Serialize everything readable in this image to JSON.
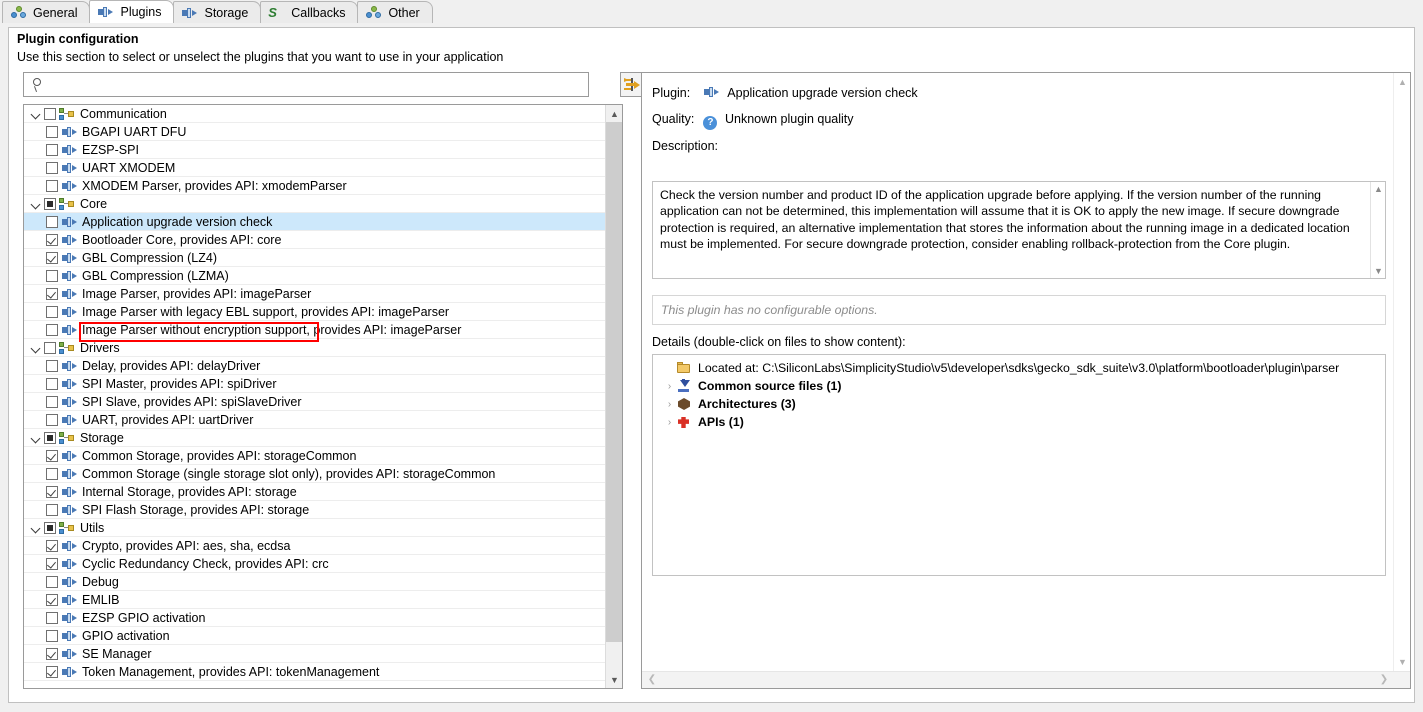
{
  "tabs": [
    {
      "label": "General",
      "icon": "clover-icon",
      "active": false
    },
    {
      "label": "Plugins",
      "icon": "plugin-icon",
      "active": true
    },
    {
      "label": "Storage",
      "icon": "plugin-icon",
      "active": false
    },
    {
      "label": "Callbacks",
      "icon": "callbacks-icon",
      "active": false
    },
    {
      "label": "Other",
      "icon": "clover-icon",
      "active": false
    }
  ],
  "group": {
    "title": "Plugin configuration",
    "subtitle": "Use this section to select or unselect the plugins that you want to use in your application"
  },
  "search": {
    "value": "",
    "placeholder": ""
  },
  "filter_button": {
    "icon": "collapse-expand-icon",
    "tooltip": ""
  },
  "tree": [
    {
      "label": "Communication",
      "level": 1,
      "type": "group",
      "check": "unchecked",
      "expanded": true,
      "selected": false
    },
    {
      "label": "BGAPI UART DFU",
      "level": 2,
      "type": "plugin",
      "check": "unchecked",
      "selected": false
    },
    {
      "label": "EZSP-SPI",
      "level": 2,
      "type": "plugin",
      "check": "unchecked",
      "selected": false
    },
    {
      "label": "UART XMODEM",
      "level": 2,
      "type": "plugin",
      "check": "unchecked",
      "selected": false
    },
    {
      "label": "XMODEM Parser, provides API: xmodemParser",
      "level": 2,
      "type": "plugin",
      "check": "unchecked",
      "selected": false
    },
    {
      "label": "Core",
      "level": 1,
      "type": "group",
      "check": "partial",
      "expanded": true,
      "selected": false
    },
    {
      "label": "Application upgrade version check",
      "level": 2,
      "type": "plugin",
      "check": "unchecked",
      "selected": true
    },
    {
      "label": "Bootloader Core, provides API: core",
      "level": 2,
      "type": "plugin",
      "check": "checked",
      "selected": false
    },
    {
      "label": "GBL Compression (LZ4)",
      "level": 2,
      "type": "plugin",
      "check": "checked",
      "selected": false
    },
    {
      "label": "GBL Compression (LZMA)",
      "level": 2,
      "type": "plugin",
      "check": "unchecked",
      "selected": false
    },
    {
      "label": "Image Parser, provides API: imageParser",
      "level": 2,
      "type": "plugin",
      "check": "checked",
      "selected": false
    },
    {
      "label": "Image Parser with legacy EBL support, provides API: imageParser",
      "level": 2,
      "type": "plugin",
      "check": "unchecked",
      "selected": false
    },
    {
      "label": "Image Parser without encryption support, provides API: imageParser",
      "level": 2,
      "type": "plugin",
      "check": "unchecked",
      "selected": false
    },
    {
      "label": "Drivers",
      "level": 1,
      "type": "group",
      "check": "unchecked",
      "expanded": true,
      "selected": false
    },
    {
      "label": "Delay, provides API: delayDriver",
      "level": 2,
      "type": "plugin",
      "check": "unchecked",
      "selected": false
    },
    {
      "label": "SPI Master, provides API: spiDriver",
      "level": 2,
      "type": "plugin",
      "check": "unchecked",
      "selected": false
    },
    {
      "label": "SPI Slave, provides API: spiSlaveDriver",
      "level": 2,
      "type": "plugin",
      "check": "unchecked",
      "selected": false
    },
    {
      "label": "UART, provides API: uartDriver",
      "level": 2,
      "type": "plugin",
      "check": "unchecked",
      "selected": false
    },
    {
      "label": "Storage",
      "level": 1,
      "type": "group",
      "check": "partial",
      "expanded": true,
      "selected": false
    },
    {
      "label": "Common Storage, provides API: storageCommon",
      "level": 2,
      "type": "plugin",
      "check": "checked",
      "selected": false
    },
    {
      "label": "Common Storage (single storage slot only), provides API: storageCommon",
      "level": 2,
      "type": "plugin",
      "check": "unchecked",
      "selected": false
    },
    {
      "label": "Internal Storage, provides API: storage",
      "level": 2,
      "type": "plugin",
      "check": "checked",
      "selected": false
    },
    {
      "label": "SPI Flash Storage, provides API: storage",
      "level": 2,
      "type": "plugin",
      "check": "unchecked",
      "selected": false
    },
    {
      "label": "Utils",
      "level": 1,
      "type": "group",
      "check": "partial",
      "expanded": true,
      "selected": false
    },
    {
      "label": "Crypto, provides API: aes, sha, ecdsa",
      "level": 2,
      "type": "plugin",
      "check": "checked",
      "selected": false
    },
    {
      "label": "Cyclic Redundancy Check, provides API: crc",
      "level": 2,
      "type": "plugin",
      "check": "checked",
      "selected": false
    },
    {
      "label": "Debug",
      "level": 2,
      "type": "plugin",
      "check": "unchecked",
      "selected": false
    },
    {
      "label": "EMLIB",
      "level": 2,
      "type": "plugin",
      "check": "checked",
      "selected": false
    },
    {
      "label": "EZSP GPIO activation",
      "level": 2,
      "type": "plugin",
      "check": "unchecked",
      "selected": false
    },
    {
      "label": "GPIO activation",
      "level": 2,
      "type": "plugin",
      "check": "unchecked",
      "selected": false
    },
    {
      "label": "SE Manager",
      "level": 2,
      "type": "plugin",
      "check": "checked",
      "selected": false
    },
    {
      "label": "Token Management, provides API: tokenManagement",
      "level": 2,
      "type": "plugin",
      "check": "checked",
      "selected": false
    }
  ],
  "details_panel": {
    "plugin_label": "Plugin:",
    "plugin_value": "Application upgrade version check",
    "quality_label": "Quality:",
    "quality_value": "Unknown plugin quality",
    "quality_badge": "?",
    "description_label": "Description:",
    "description_text": "Check the version number and product ID of the application upgrade before applying. If the version number of the running application can not be determined, this implementation will assume that it is OK to apply the new image. If secure downgrade protection is required, an alternative implementation that stores the information about the running image in a dedicated location must be implemented. For secure downgrade protection, consider enabling rollback-protection from the Core plugin.",
    "no_options_text": "This plugin has no configurable options.",
    "details_label": "Details (double-click on files to show content):",
    "details_items": [
      {
        "text": "Located at: C:\\SiliconLabs\\SimplicityStudio\\v5\\developer\\sdks\\gecko_sdk_suite\\v3.0\\platform\\bootloader\\plugin\\parser",
        "icon": "folder-icon",
        "bold": false,
        "expandable": false
      },
      {
        "text": "Common source files (1)",
        "icon": "source-files-icon",
        "bold": true,
        "expandable": true
      },
      {
        "text": "Architectures (3)",
        "icon": "architecture-icon",
        "bold": true,
        "expandable": true
      },
      {
        "text": "APIs (1)",
        "icon": "api-icon",
        "bold": true,
        "expandable": true
      }
    ]
  },
  "colors": {
    "selection": "#cde8fb",
    "annotation": "#ff0000",
    "accent": "#4a90d9"
  }
}
